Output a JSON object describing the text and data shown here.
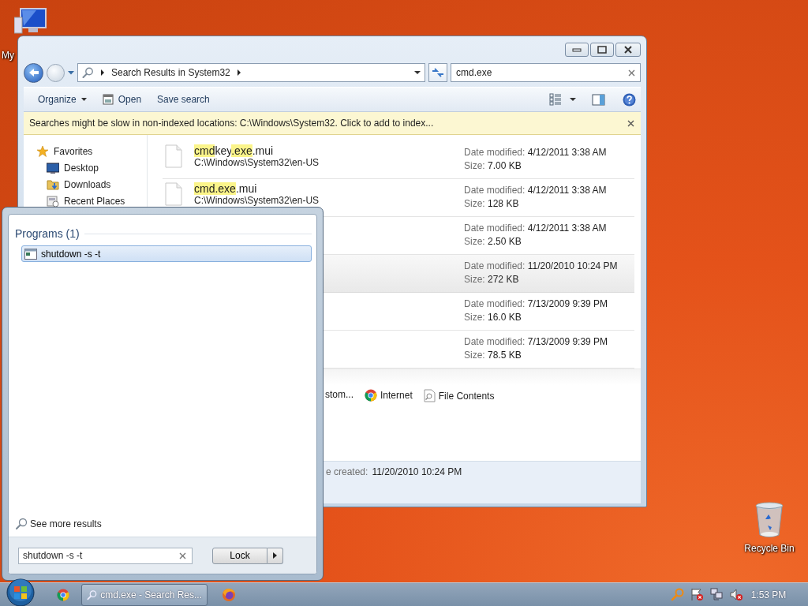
{
  "desktop_icons": [
    {
      "label": "My",
      "kind": "computer"
    },
    {
      "label": "Recycle Bin",
      "kind": "recycle"
    }
  ],
  "explorer": {
    "address": "Search Results in System32",
    "search": {
      "value": "cmd.exe"
    },
    "toolbar": [
      {
        "label": "Organize",
        "kind": "menu"
      },
      {
        "label": "Open",
        "kind": "icon"
      },
      {
        "label": "Save search",
        "kind": "plain"
      }
    ],
    "info_bar": "Searches might be slow in non-indexed locations: C:\\Windows\\System32. Click to add to index...",
    "nav": [
      {
        "label": "Favorites",
        "kind": "star",
        "children": [
          {
            "label": "Desktop",
            "kind": "desktop"
          },
          {
            "label": "Downloads",
            "kind": "downloads"
          },
          {
            "label": "Recent Places",
            "kind": "recent"
          }
        ]
      }
    ],
    "results": [
      {
        "name": [
          {
            "text": "cmd",
            "highlighted": true
          },
          {
            "text": "key",
            "highlighted": false
          },
          {
            "text": ".exe",
            "highlighted": true
          },
          {
            "text": ".mui",
            "highlighted": false
          }
        ],
        "path": "C:\\Windows\\System32\\en-US",
        "date_label": "Date modified:",
        "date": "4/12/2011 3:38 AM",
        "size_label": "Size:",
        "size": "7.00 KB",
        "selected": false
      },
      {
        "name": [
          {
            "text": "cmd.exe",
            "highlighted": true
          },
          {
            "text": ".mui",
            "highlighted": false
          }
        ],
        "path": "C:\\Windows\\System32\\en-US",
        "date_label": "Date modified:",
        "date": "4/12/2011 3:38 AM",
        "size_label": "Size:",
        "size": "128 KB",
        "selected": false
      },
      {
        "date_label": "Date modified:",
        "date": "4/12/2011 3:38 AM",
        "size_label": "Size:",
        "size": "2.50 KB",
        "selected": false
      },
      {
        "date_label": "Date modified:",
        "date": "11/20/2010 10:24 PM",
        "size_label": "Size:",
        "size": "272 KB",
        "selected": true
      },
      {
        "date_label": "Date modified:",
        "date": "7/13/2009 9:39 PM",
        "size_label": "Size:",
        "size": "16.0 KB",
        "selected": false
      },
      {
        "date_label": "Date modified:",
        "date": "7/13/2009 9:39 PM",
        "size_label": "Size:",
        "size": "78.5 KB",
        "selected": false
      }
    ],
    "search_again": [
      {
        "label": "stom...",
        "kind": "text"
      },
      {
        "label": "Internet",
        "kind": "internet"
      },
      {
        "label": "File Contents",
        "kind": "contents"
      }
    ],
    "details": {
      "label": "e created:",
      "value": "11/20/2010 10:24 PM"
    }
  },
  "start_menu": {
    "group": "Programs (1)",
    "programs": [
      {
        "label": "shutdown -s -t",
        "selected": true
      }
    ],
    "more_results": "See more results",
    "search": {
      "value": "shutdown -s -t"
    },
    "power_button": "Lock"
  },
  "taskbar": {
    "task": "cmd.exe - Search Res...",
    "clock": "1:53 PM"
  }
}
